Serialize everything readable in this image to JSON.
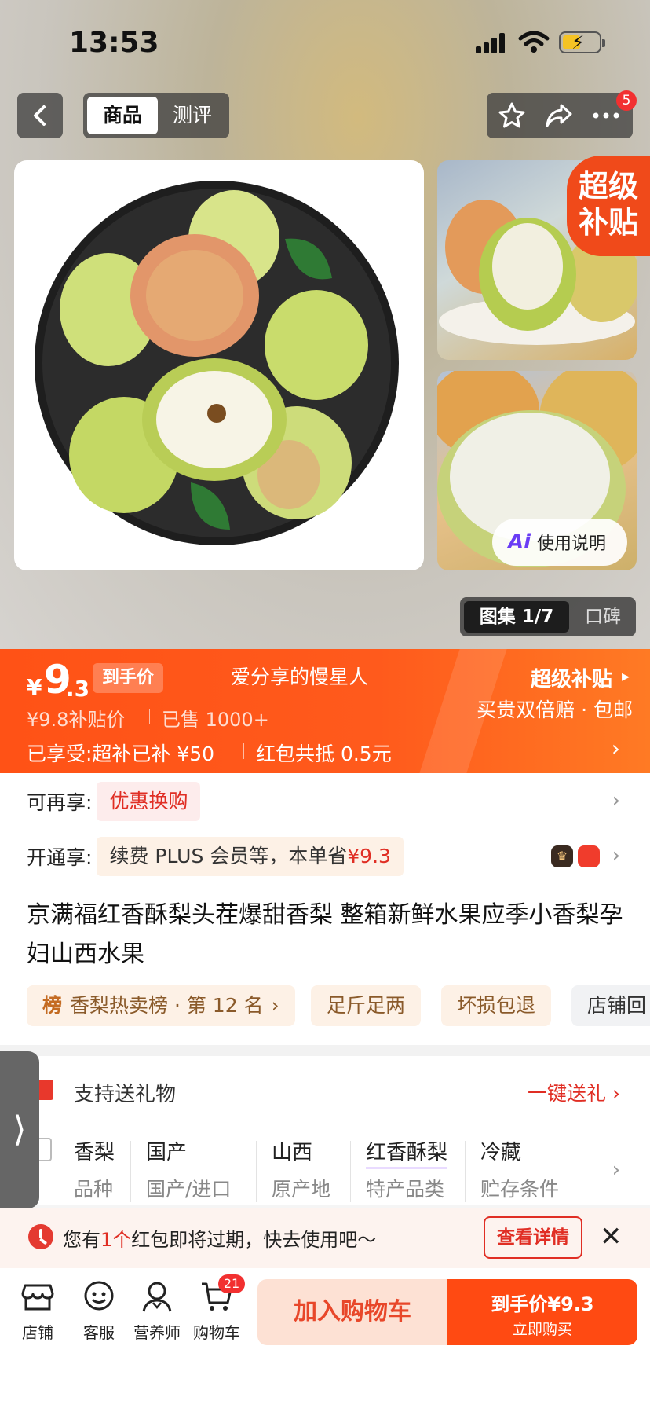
{
  "status_bar": {
    "time": "13:53"
  },
  "nav": {
    "tabs": [
      {
        "label": "商品"
      },
      {
        "label": "测评"
      }
    ],
    "badge_count": "5"
  },
  "gallery": {
    "super_subsidy_badge_line1": "超级",
    "super_subsidy_badge_line2": "补贴",
    "ai_chip": {
      "ai_label": "Ai",
      "label": "使用说明"
    },
    "gallery_tab": "图集 1/7",
    "reviews_tab": "口碑"
  },
  "price": {
    "currency": "¥",
    "integer": "9",
    "decimal": ".3",
    "final_label": "到手价",
    "nickname": "爱分享的慢星人",
    "original": "¥9.8补贴价",
    "sold": "已售 1000+",
    "enjoyed": "已享受:超补已补 ¥50",
    "redpacket": "红包共抵 0.5元",
    "subsidy_title": "超级补贴",
    "subsidy_sub": "买贵双倍赔 · 包邮"
  },
  "offers": {
    "more_label": "可再享:",
    "more_chip": "优惠换购",
    "open_label": "开通享:",
    "open_chip_text": "续费 PLUS 会员等，本单省",
    "open_chip_price": "¥9.3"
  },
  "product": {
    "title": "京满福红香酥梨头茬爆甜香梨 整箱新鲜水果应季小香梨孕妇山西水果",
    "tags": [
      {
        "label": "香梨热卖榜 · 第 12 名",
        "prefix": "榜"
      },
      {
        "label": "足斤足两"
      },
      {
        "label": "坏损包退"
      },
      {
        "label": "店铺回"
      }
    ]
  },
  "gift": {
    "label": "支持送礼物",
    "link": "一键送礼"
  },
  "specs": [
    {
      "value": "香梨",
      "key": "品种"
    },
    {
      "value": "国产",
      "key": "国产/进口"
    },
    {
      "value": "山西",
      "key": "原产地"
    },
    {
      "value": "红香酥梨",
      "key": "特产品类"
    },
    {
      "value": "冷藏",
      "key": "贮存条件"
    }
  ],
  "notice": {
    "text_prefix": "您有",
    "count": "1个",
    "text_suffix": "红包即将过期，快去使用吧～",
    "button": "查看详情"
  },
  "bottom_bar": {
    "items": [
      {
        "label": "店铺",
        "icon": "store-icon"
      },
      {
        "label": "客服",
        "icon": "chat-icon"
      },
      {
        "label": "营养师",
        "icon": "nutritionist-icon"
      },
      {
        "label": "购物车",
        "icon": "cart-icon"
      }
    ],
    "cart_badge": "21",
    "add_to_cart": "加入购物车",
    "buy_line1": "到手价¥9.3",
    "buy_line2": "立即购买"
  },
  "colors": {
    "accent": "#ff5216",
    "price_red": "#e02e24",
    "badge_red": "#f23030"
  }
}
